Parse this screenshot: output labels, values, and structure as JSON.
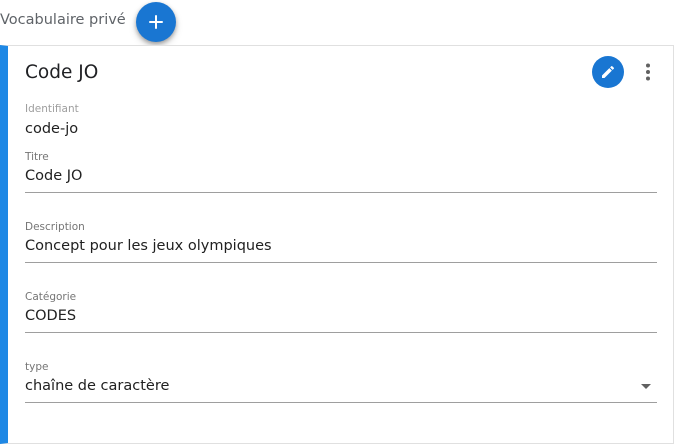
{
  "header": {
    "title": "Vocabulaire privé",
    "add_icon": "plus-icon",
    "accent": "#1976d2"
  },
  "card": {
    "title": "Code JO",
    "accent_border": "#1e88e5",
    "edit_icon": "pencil-icon",
    "menu_icon": "more-vertical-icon",
    "identifiant": {
      "label": "Identifiant",
      "value": "code-jo"
    },
    "fields": {
      "titre": {
        "label": "Titre",
        "value": "Code JO"
      },
      "description": {
        "label": "Description",
        "value": "Concept pour les jeux olympiques"
      },
      "categorie": {
        "label": "Catégorie",
        "value": "CODES"
      },
      "type": {
        "label": "type",
        "value": "chaîne de caractère"
      }
    }
  }
}
